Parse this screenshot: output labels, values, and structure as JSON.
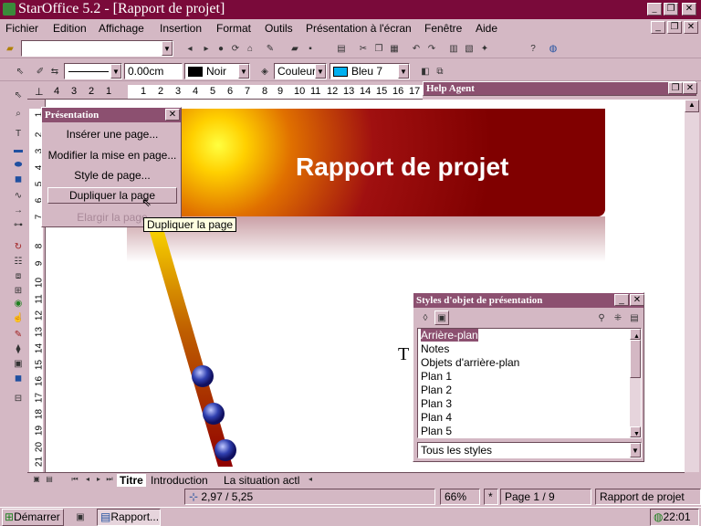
{
  "window": {
    "title": "StarOffice 5.2 - [Rapport de projet]"
  },
  "menu": [
    "Fichier",
    "Edition",
    "Affichage",
    "Insertion",
    "Format",
    "Outils",
    "Présentation à l'écran",
    "Fenêtre",
    "Aide"
  ],
  "toolbar": {
    "line_width": "0.00cm",
    "line_color": "Noir",
    "fill_type": "Couleur",
    "fill_color": "Bleu 7"
  },
  "ruler": {
    "h_ticks": [
      "4",
      "3",
      "2",
      "1",
      "1",
      "2",
      "3",
      "4",
      "5",
      "6",
      "7",
      "8",
      "9",
      "10",
      "11",
      "12",
      "13",
      "14",
      "15",
      "16",
      "17"
    ],
    "v_ticks": [
      "1",
      "2",
      "3",
      "4",
      "5",
      "6",
      "7",
      "8",
      "9",
      "10",
      "11",
      "12",
      "13",
      "14",
      "15",
      "16",
      "17",
      "18",
      "19",
      "20",
      "21"
    ]
  },
  "slide": {
    "title": "Rapport de projet",
    "text_cursor": "T"
  },
  "presentation_panel": {
    "title": "Présentation",
    "items": [
      "Insérer une page...",
      "Modifier la mise en page...",
      "Style de page...",
      "Dupliquer la page",
      "Elargir la page"
    ],
    "tooltip": "Dupliquer la page"
  },
  "help_agent": {
    "title": "Help Agent"
  },
  "styles_panel": {
    "title": "Styles d'objet de présentation",
    "items": [
      "Arrière-plan",
      "Notes",
      "Objets d'arrière-plan",
      "Plan 1",
      "Plan 2",
      "Plan 3",
      "Plan 4",
      "Plan 5"
    ],
    "filter": "Tous les styles"
  },
  "tabs": [
    "Titre",
    "Introduction",
    "La situation actl"
  ],
  "status": {
    "position": "2,97 / 5,25",
    "zoom": "66%",
    "modified": "*",
    "page": "Page 1 / 9",
    "document": "Rapport de projet"
  },
  "taskbar": {
    "start": "Démarrer",
    "task": "Rapport...",
    "clock": "22:01"
  },
  "colors": {
    "title_bar": "#7a0a3a",
    "chrome": "#d4b8c4",
    "panel_header": "#8c5070",
    "selection": "#8c5070"
  }
}
